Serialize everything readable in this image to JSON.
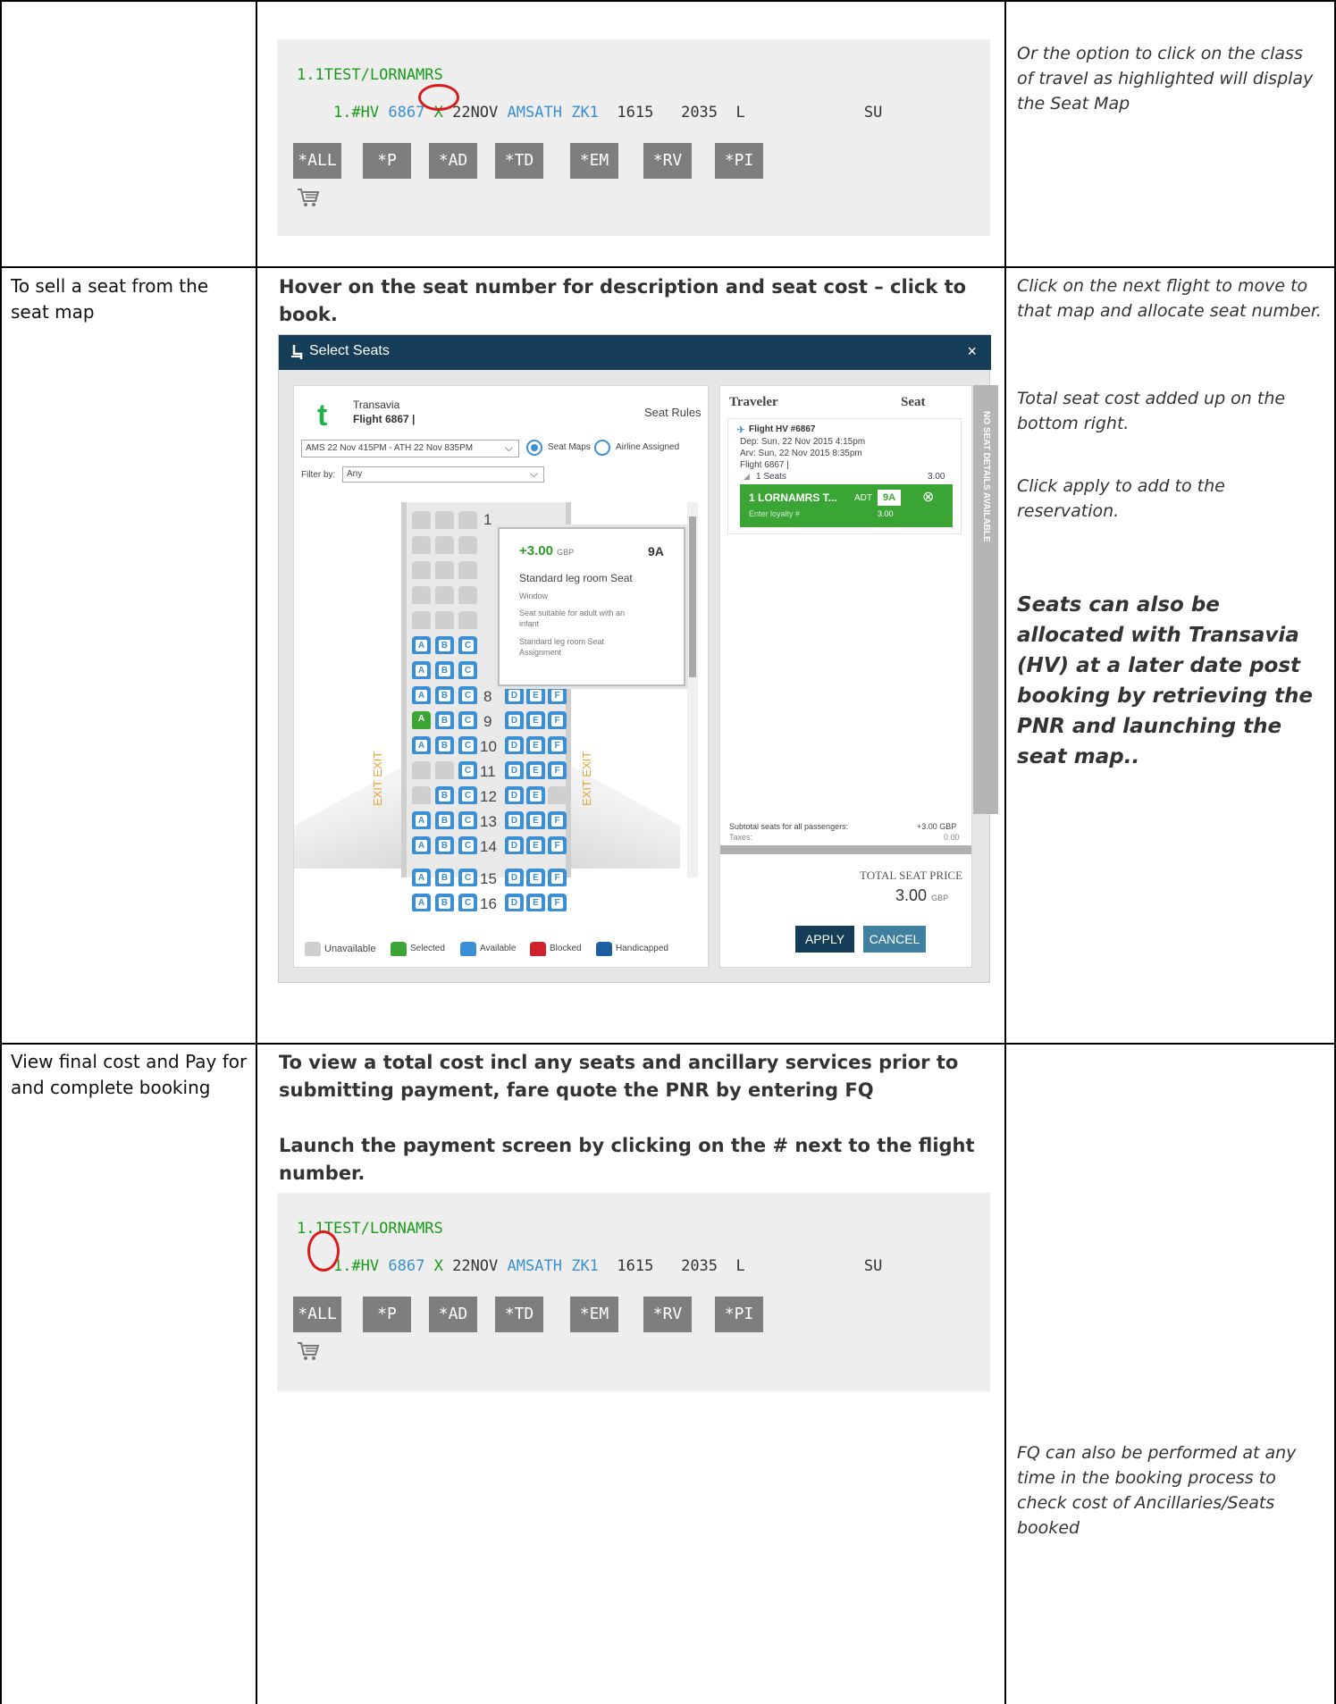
{
  "row1": {
    "terminal": {
      "line1": "1.1TEST/LORNAMRS",
      "line2": {
        "num": "1.#HV",
        "flight": "6867",
        "cls": "X",
        "date": "22NOV",
        "route": "AMSATH",
        "status": "ZK1",
        "dep": "1615",
        "arr": "2035",
        "meal": "L",
        "days": "SU"
      },
      "buttons": [
        "*ALL",
        "*P",
        "*AD",
        "*TD",
        "*EM",
        "*RV",
        "*PI"
      ]
    },
    "note": "Or the option to click on the class of travel as highlighted will display the Seat Map"
  },
  "row2": {
    "label": "To sell a seat from the seat map",
    "instruction": "Hover on the seat number for description and seat cost – click to book.",
    "notes": [
      "Click on the next flight to move to that map and allocate seat number.",
      "Total seat cost added up on the bottom right.",
      "Click apply to add to the reservation."
    ],
    "note_strong": "Seats can also be allocated with Transavia (HV) at a later date post booking by retrieving the PNR and launching the seat map..",
    "modal": {
      "title": "Select Seats",
      "close": "×",
      "airline": "Transavia",
      "flight": "Flight 6867 |",
      "seat_rules": "Seat Rules",
      "segment": "AMS 22 Nov 415PM - ATH 22 Nov 835PM",
      "seat_maps": "Seat Maps",
      "airline_assigned": "Airline Assigned",
      "filter_label": "Filter by:",
      "filter_value": "Any",
      "rows": [
        "1",
        "8",
        "9",
        "10",
        "11",
        "12",
        "13",
        "14",
        "15",
        "16"
      ],
      "exit": "EXIT EXIT",
      "tooltip": {
        "price": "+3.00",
        "currency": "GBP",
        "seat": "9A",
        "desc": "Standard leg room Seat",
        "window": "Window",
        "infant": "Seat suitable for adult with an infant",
        "assignment": "Standard leg room Seat Assignment"
      },
      "legend": [
        "Unavailable",
        "Selected",
        "Available",
        "Blocked",
        "Handicapped"
      ],
      "traveler_header": "Traveler",
      "seat_header": "Seat",
      "flight_hv": "Flight HV #6867",
      "dep": "Dep: Sun, 22 Nov 2015 4:15pm",
      "arv": "Arv: Sun, 22 Nov 2015 8:35pm",
      "flight_num": "Flight 6867 |",
      "seats_count": "1 Seats",
      "seats_cost": "3.00",
      "pax": "1 LORNAMRS T...",
      "pax_type": "ADT",
      "pax_seat": "9A",
      "loyalty": "Enter loyalty #",
      "pax_cost": "3.00",
      "side_label": "NO SEAT DETAILS AVAILABLE",
      "subtotal_label": "Subtotal seats for all passengers:",
      "subtotal_value": "+3.00 GBP",
      "taxes_label": "Taxes:",
      "taxes_value": "0.00",
      "total_label": "TOTAL SEAT PRICE",
      "total_value": "3.00",
      "total_currency": "GBP",
      "apply": "APPLY",
      "cancel": "CANCEL"
    }
  },
  "row3": {
    "label": "View final cost and Pay for and complete booking",
    "instruction1": "To view a total cost incl any seats and ancillary services prior to submitting payment, fare quote the PNR by entering FQ",
    "instruction2": "Launch the payment screen by clicking on the # next to the flight number.",
    "terminal": {
      "line1": "1.1TEST/LORNAMRS",
      "line2": {
        "num": "1.#HV",
        "flight": "6867",
        "cls": "X",
        "date": "22NOV",
        "route": "AMSATH",
        "status": "ZK1",
        "dep": "1615",
        "arr": "2035",
        "meal": "L",
        "days": "SU"
      },
      "buttons": [
        "*ALL",
        "*P",
        "*AD",
        "*TD",
        "*EM",
        "*RV",
        "*PI"
      ]
    },
    "note": "FQ can also be performed at any time in the booking process to check cost of Ancillaries/Seats booked"
  }
}
